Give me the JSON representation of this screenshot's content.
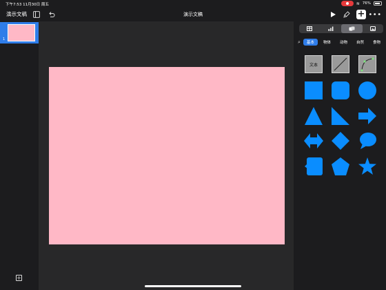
{
  "status": {
    "time": "下午7:53  11月30日 周五",
    "battery": "76%"
  },
  "toolbar": {
    "documents_label": "演示文稿",
    "title": "演示文稿"
  },
  "slides": [
    {
      "number": "1"
    }
  ],
  "panel": {
    "segments": [
      "table-icon",
      "chart-icon",
      "shapes-icon",
      "media-icon"
    ],
    "categories": [
      "基本",
      "物体",
      "动物",
      "自然",
      "食物"
    ],
    "text_shape_label": "文本"
  },
  "colors": {
    "accent": "#2f7de9",
    "shape_blue": "#0a8dff",
    "slide_fill": "#ffb8c6"
  }
}
